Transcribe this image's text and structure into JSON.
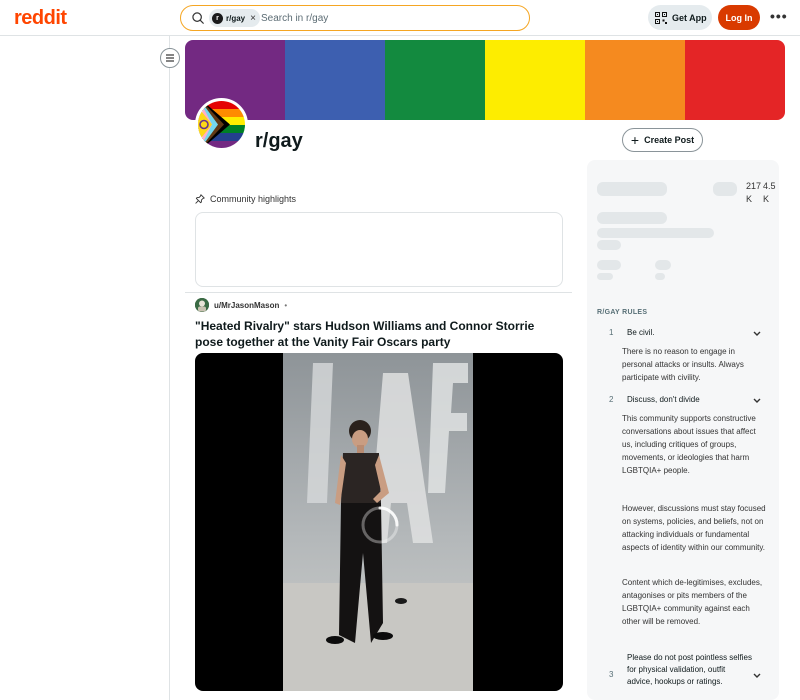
{
  "header": {
    "logo": "reddit",
    "search_chip": "r/gay",
    "search_chip_close": "×",
    "search_placeholder": "Search in r/gay",
    "get_app": "Get App",
    "login": "Log In",
    "more": "•••"
  },
  "colors": {
    "brand": "#ff4500",
    "login": "#d93a00",
    "banner_stripes": [
      "#732982",
      "#3d5fb0",
      "#138a3f",
      "#fded00",
      "#f58a1f",
      "#e42526"
    ]
  },
  "subreddit": {
    "name": "r/gay",
    "create_post": "Create Post"
  },
  "highlights": {
    "label": "Community highlights"
  },
  "post": {
    "author": "u/MrJasonMason",
    "separator": "•",
    "title": "\"Heated Rivalry\" stars Hudson Williams and Connor Storrie pose together at the Vanity Fair Oscars party"
  },
  "sidebar": {
    "stat1": "217\nK",
    "stat2": "4.5\nK",
    "rules_heading": "R/GAY RULES",
    "rules": [
      {
        "num": "1",
        "title": "Be civil.",
        "text": "There is no reason to engage in personal attacks or insults. Always participate with civility."
      },
      {
        "num": "2",
        "title": "Discuss, don't divide",
        "text": "This community supports constructive conversations about issues that affect us, including critiques of groups, movements, or ideologies that harm LGBTQIA+ people.",
        "text2": "However, discussions must stay focused on systems, policies, and beliefs, not on attacking individuals or fundamental aspects of identity within our community.",
        "text3": "Content which de-legitimises, excludes, antagonises or pits members of the LGBTQIA+ community against each other will be removed."
      },
      {
        "num": "3",
        "title": "Please do not post pointless selfies for physical validation, outfit advice, hookups or ratings."
      }
    ]
  }
}
